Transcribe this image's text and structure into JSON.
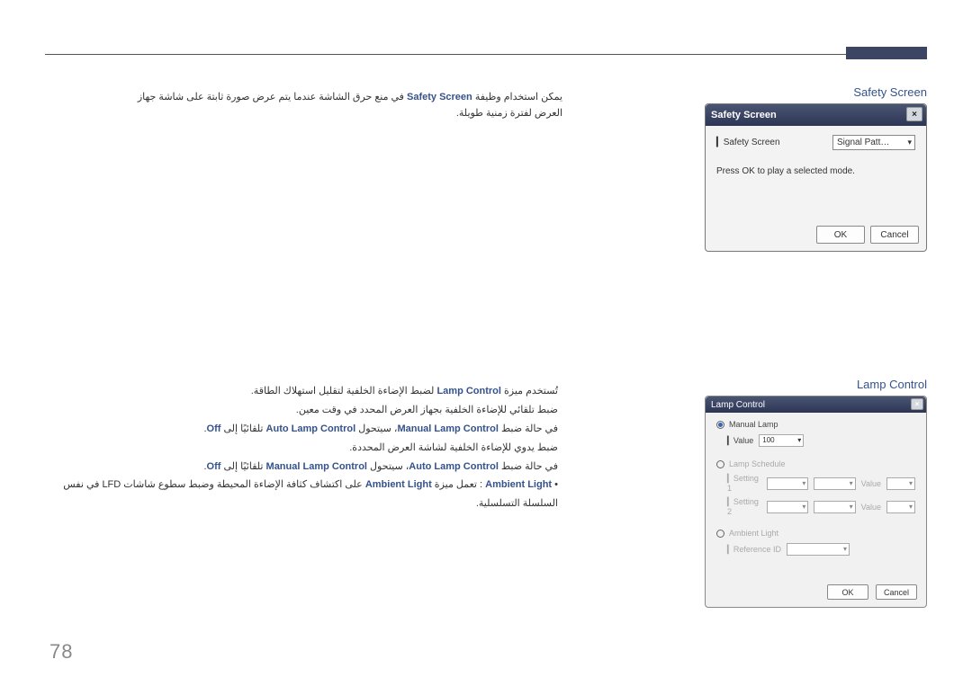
{
  "page_number": "78",
  "section1": {
    "title_en": "Safety Screen",
    "text_line1_pre": "يمكن استخدام وظيفة ",
    "feature": "Safety Screen",
    "text_line1_post": " في منع حرق الشاشة عندما يتم عرض صورة ثابتة على شاشة جهاز العرض لفترة زمنية طويلة."
  },
  "dlg1": {
    "title": "Safety Screen",
    "close": "×",
    "label": "Safety Screen",
    "select_value": "Signal Patt…",
    "msg": "Press OK to play a selected mode.",
    "ok": "OK",
    "cancel": "Cancel"
  },
  "section2": {
    "title_en": "Lamp Control",
    "line1_pre": "تُستخدم ميزة ",
    "feature": "Lamp Control",
    "line1_post": " لضبط الإضاءة الخلفية لتقليل استهلاك الطاقة.",
    "line2": "ضبط تلقائي للإضاءة الخلفية بجهاز العرض المحدد في وقت معين.",
    "line3_pre": "في حالة ضبط ",
    "line3_a": "Manual Lamp Control",
    "line3_mid": "، سيتحول ",
    "line3_b": "Auto Lamp Control",
    "line3_suf": " تلقائيًا إلى ",
    "line3_off": "Off",
    "line3_dot": ".",
    "line4": "ضبط يدوي للإضاءة الخلفية لشاشة العرض المحددة.",
    "line5_pre": "في حالة ضبط ",
    "line5_a": "Auto Lamp Control",
    "line5_mid": "، سيتحول ",
    "line5_b": "Manual Lamp Control",
    "line5_suf": " تلقائيًا إلى ",
    "line5_off": "Off",
    "line5_dot": ".",
    "bullet_feature": "Ambient Light",
    "bullet_mid": " : تعمل ميزة ",
    "bullet_feature2": "Ambient Light",
    "bullet_post": " على اكتشاف كثافة الإضاءة المحيطة وضبط سطوع شاشات LFD في نفس السلسلة التسلسلية."
  },
  "dlg2": {
    "title": "Lamp Control",
    "close": "×",
    "manual_lamp": "Manual Lamp",
    "value_lbl": "Value",
    "value_val": "100",
    "lamp_schedule": "Lamp Schedule",
    "setting1": "Setting 1",
    "setting2": "Setting 2",
    "sched_value": "Value",
    "ambient": "Ambient Light",
    "reference": "Reference ID",
    "ok": "OK",
    "cancel": "Cancel"
  }
}
